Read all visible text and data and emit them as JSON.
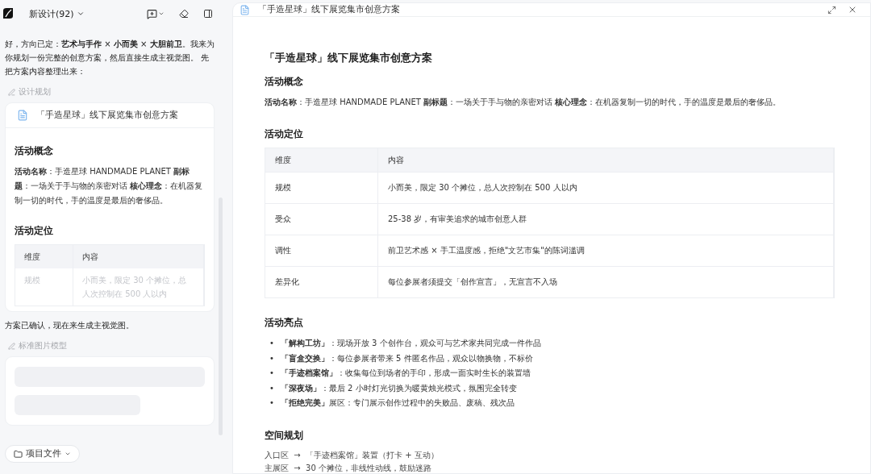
{
  "app": {
    "title": "新设计(92)"
  },
  "chat": {
    "intro": "好，方向已定：**艺术与手作** × **小而美** × **大胆前卫**。我来为你规划一份完整的创意方案，然后直接生成主视觉图。 先把方案内容整理出来：",
    "plan_label": "设计规划",
    "plan_card": {
      "title": "「手造星球」线下展览集市创意方案",
      "concept_heading": "活动概念",
      "concept_text": "**活动名称**：手造星球 HANDMADE PLANET **副标题**：一场关于手与物的亲密对话 **核心理念**：在机器复制一切的时代，手的温度是最后的奢侈品。",
      "position_heading": "活动定位",
      "columns": [
        "维度",
        "内容"
      ],
      "rows": [
        [
          "规模",
          "小而美，限定 30 个摊位，总人次控制在 500 人以内"
        ]
      ]
    },
    "confirm": "方案已确认，现在来生成主视觉图。",
    "model_label": "标准图片模型",
    "image_loading": true
  },
  "project_files": "项目文件",
  "document": {
    "tab_title": "「手造星球」线下展览集市创意方案",
    "title": "「手造星球」线下展览集市创意方案",
    "sections": [
      {
        "kind": "paragraph",
        "heading": "活动概念",
        "text": "**活动名称**：手造星球 HANDMADE PLANET **副标题**：一场关于手与物的亲密对话 **核心理念**：在机器复制一切的时代，手的温度是最后的奢侈品。"
      },
      {
        "kind": "table",
        "heading": "活动定位",
        "columns": [
          "维度",
          "内容"
        ],
        "rows": [
          [
            "规模",
            "小而美，限定 30 个摊位，总人次控制在 500 人以内"
          ],
          [
            "受众",
            "25-38 岁，有审美追求的城市创意人群"
          ],
          [
            "调性",
            "前卫艺术感 × 手工温度感，拒绝\"文艺市集\"的陈词滥调"
          ],
          [
            "差异化",
            "每位参展者须提交「创作宣言」，无宣言不入场"
          ]
        ]
      },
      {
        "kind": "bullets",
        "heading": "活动亮点",
        "marker": "•",
        "items": [
          "**「解构工坊」**：现场开放 3 个创作台，观众可与艺术家共同完成一件作品",
          "**「盲盒交换」**：每位参展者带来 5 件匿名作品，观众以物换物，不标价",
          "**「手迹档案馆」**：收集每位到场者的手印，形成一面实时生长的装置墙",
          "**「深夜场」**：最后 2 小时灯光切换为暖黄烛光模式，氛围完全转变",
          "**「拒绝完美」**展区：专门展示创作过程中的失败品、废稿、残次品"
        ]
      },
      {
        "kind": "lines",
        "heading": "空间规划",
        "lines": [
          "入口区  →  「手迹档案馆」装置（打卡 + 互动）",
          "主展区  →  30 个摊位，非线性动线，鼓励迷路"
        ]
      }
    ]
  }
}
